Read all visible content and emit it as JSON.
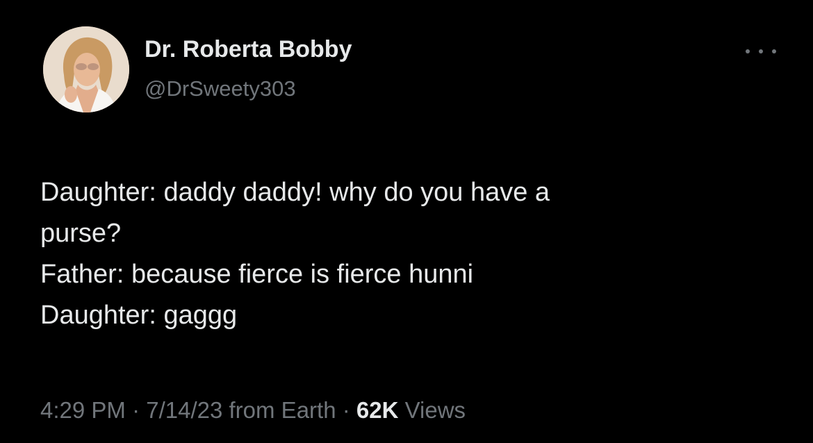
{
  "author": {
    "display_name": "Dr. Roberta Bobby",
    "handle": "@DrSweety303",
    "avatar_icon": "profile-photo"
  },
  "more_menu_icon": "more-options-icon",
  "tweet": {
    "lines": [
      "Daughter: daddy daddy! why do you have a",
      "purse?",
      "Father: because fierce is fierce hunni",
      "Daughter: gaggg"
    ]
  },
  "meta": {
    "time": "4:29 PM",
    "separator1": " · ",
    "date": "7/14/23",
    "source": " from Earth",
    "separator2": " · ",
    "views_count": "62K",
    "views_label": " Views"
  },
  "colors": {
    "background": "#000000",
    "primary_text": "#e7e9ea",
    "secondary_text": "#71767b"
  }
}
